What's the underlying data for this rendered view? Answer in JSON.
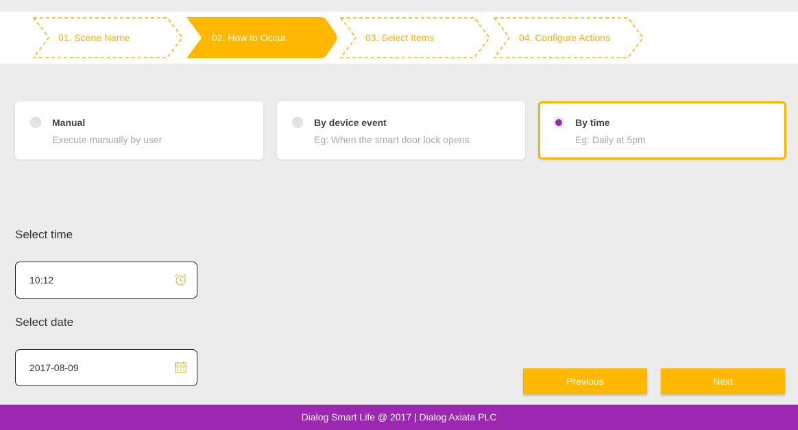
{
  "stepper": {
    "steps": [
      {
        "label": "01. Scene Name",
        "active": false
      },
      {
        "label": "02. How to Occur",
        "active": true
      },
      {
        "label": "03. Select Items",
        "active": false
      },
      {
        "label": "04. Configure Actions",
        "active": false
      }
    ]
  },
  "occurrence_options": [
    {
      "title": "Manual",
      "description": "Execute manually by user",
      "selected": false
    },
    {
      "title": "By device event",
      "description": "Eg: When the smart door lock opens",
      "selected": false
    },
    {
      "title": "By time",
      "description": "Eg: Daily at 5pm",
      "selected": true
    }
  ],
  "time": {
    "label": "Select time",
    "value": "10:12",
    "icon": "alarm-clock-icon"
  },
  "date": {
    "label": "Select date",
    "value": "2017-08-09",
    "icon": "calendar-icon"
  },
  "buttons": {
    "previous": "Previous",
    "next": "Next"
  },
  "footer": {
    "text": "Dialog Smart Life @ 2017 | Dialog Axiata PLC"
  },
  "colors": {
    "accent": "#ffb800",
    "brand_purple": "#9c27b0",
    "background": "#ececec"
  }
}
